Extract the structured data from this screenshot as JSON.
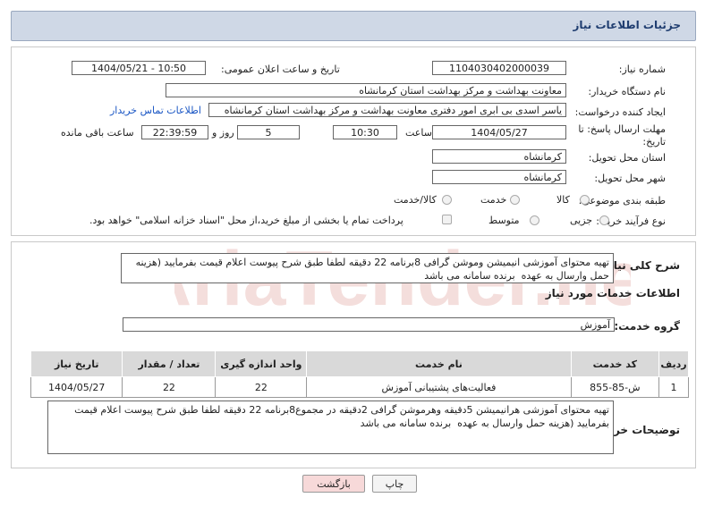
{
  "header": {
    "title": "جزئیات اطلاعات نیاز"
  },
  "form": {
    "need_number_label": "شماره نیاز:",
    "need_number": "1104030402000039",
    "announce_label": "تاریخ و ساعت اعلان عمومی:",
    "announce_value": "1404/05/21 - 10:50",
    "buyer_label": "نام دستگاه خریدار:",
    "buyer_value": "معاونت بهداشت و مرکز بهداشت استان کرمانشاه",
    "creator_label": "ایجاد کننده درخواست:",
    "creator_value": "یاسر اسدی بی ابری امور دفتری معاونت بهداشت و مرکز بهداشت استان کرمانشاه",
    "contact_link": "اطلاعات تماس خریدار",
    "deadline_label": "مهلت ارسال پاسخ: تا تاریخ:",
    "deadline_date": "1404/05/27",
    "time_label": "ساعت",
    "deadline_time": "10:30",
    "days_value": "5",
    "days_label": "روز و",
    "remaining_time": "22:39:59",
    "remaining_label": "ساعت باقی مانده",
    "province_label": "استان محل تحویل:",
    "province_value": "کرمانشاه",
    "city_label": "شهر محل تحویل:",
    "city_value": "کرمانشاه",
    "category_label": "طبقه بندی موضوعی:",
    "category_options": [
      "کالا",
      "خدمت",
      "کالا/خدمت"
    ],
    "process_label": "نوع فرآیند خرید :",
    "process_options": [
      "جزیی",
      "متوسط"
    ],
    "payment_note": "پرداخت تمام یا بخشی از مبلغ خرید،از محل \"اسناد خزانه اسلامی\" خواهد بود."
  },
  "details": {
    "summary_label": "شرح کلی نیاز:",
    "summary_text": "تهیه محتوای آموزشی انیمیشن وموشن گرافی 8برنامه 22 دقیقه لطفا طبق شرح پیوست اعلام قیمت بفرمایید (هزینه حمل وارسال به عهده  برنده سامانه می باشد",
    "services_title": "اطلاعات خدمات مورد نیاز",
    "service_group_label": "گروه خدمت:",
    "service_group_value": "آموزش",
    "table": {
      "headers": [
        "ردیف",
        "کد خدمت",
        "نام خدمت",
        "واحد اندازه گیری",
        "تعداد / مقدار",
        "تاریخ نیاز"
      ],
      "rows": [
        [
          "1",
          "ش-85-855",
          "فعالیت‌های پشتیبانی آموزش",
          "22",
          "22",
          "1404/05/27"
        ]
      ]
    },
    "buyer_notes_label": "توضیحات خریدار:",
    "buyer_notes_text": "تهیه محتوای آموزشی هرانیمیشن 5دقیقه وهرموشن گرافی 2دقیقه در مجموع8برنامه 22 دقیقه لطفا طبق شرح پیوست اعلام قیمت بفرمایید (هزینه حمل وارسال به عهده  برنده سامانه می باشد"
  },
  "buttons": {
    "print": "چاپ",
    "back": "بازگشت"
  },
  "watermark": {
    "text": "AriaTender.net"
  },
  "colors": {
    "header_bg": "#cfd8e6",
    "link": "#1a56c4",
    "back_btn_bg": "#f7d9d9",
    "watermark": "#c0392b"
  }
}
